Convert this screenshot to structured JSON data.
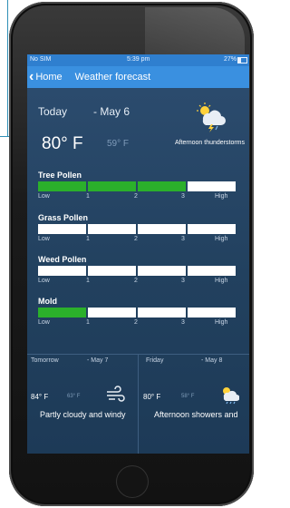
{
  "status_bar": {
    "carrier": "No SIM",
    "time": "5:39 pm",
    "battery": "27%"
  },
  "nav": {
    "back_label": "Home",
    "title": "Weather forecast"
  },
  "today": {
    "label": "Today",
    "date": "- May 6",
    "temp_high": "80° F",
    "temp_low": "59° F",
    "condition": "Afternoon thunderstorms",
    "icon": "thunderstorm-icon"
  },
  "pollen": [
    {
      "name": "Tree Pollen",
      "level_segments": 3,
      "scale": [
        "Low",
        "1",
        "2",
        "3",
        "High"
      ]
    },
    {
      "name": "Grass Pollen",
      "level_segments": 0,
      "scale": [
        "Low",
        "1",
        "2",
        "3",
        "High"
      ]
    },
    {
      "name": "Weed Pollen",
      "level_segments": 0,
      "scale": [
        "Low",
        "1",
        "2",
        "3",
        "High"
      ]
    },
    {
      "name": "Mold",
      "level_segments": 1,
      "scale": [
        "Low",
        "1",
        "2",
        "3",
        "High"
      ]
    }
  ],
  "forecast": [
    {
      "day": "Tomorrow",
      "date": "- May 7",
      "temp_high": "84° F",
      "temp_low": "63° F",
      "condition": "Partly cloudy and windy",
      "icon": "wind-icon"
    },
    {
      "day": "Friday",
      "date": "- May 8",
      "temp_high": "80° F",
      "temp_low": "58° F",
      "condition": "Afternoon showers and",
      "icon": "rain-showers-icon"
    }
  ],
  "colors": {
    "navbar": "#3a90e0",
    "status_bar": "#2f7fcf",
    "screen_bg": "#22415f",
    "pollen_level": "#2bb02b",
    "pollen_empty": "#ffffff"
  }
}
